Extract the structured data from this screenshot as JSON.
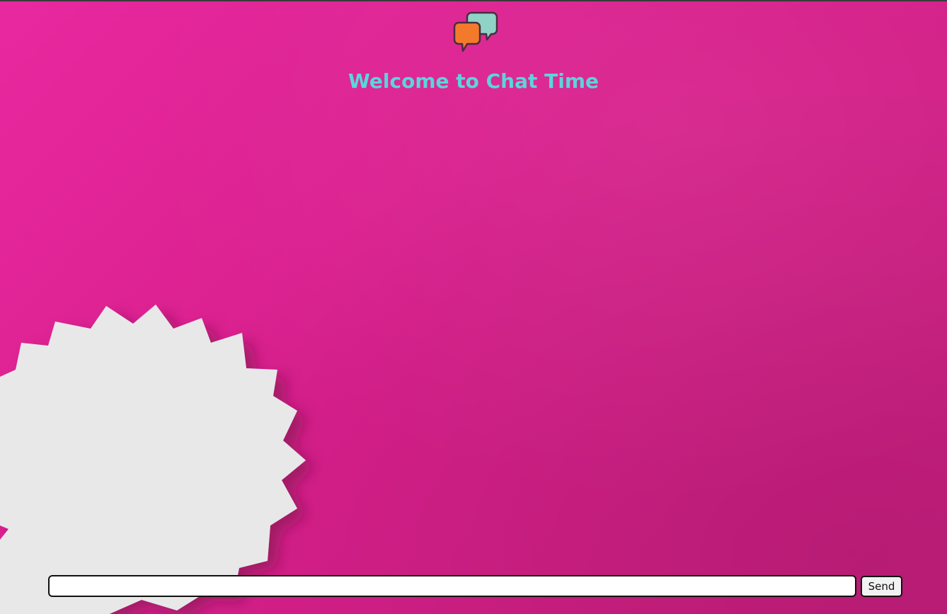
{
  "header": {
    "logo_icon": "chat-bubbles-icon",
    "title": "Welcome to Chat Time"
  },
  "composer": {
    "input_value": "",
    "input_placeholder": "",
    "send_label": "Send"
  },
  "colors": {
    "background": "#d81f8c",
    "title": "#5ad6da",
    "logo_orange": "#f47a2b",
    "logo_teal": "#8fd3c6",
    "logo_outline": "#4a2d3f",
    "paper_bubble": "#e9e9e9"
  }
}
